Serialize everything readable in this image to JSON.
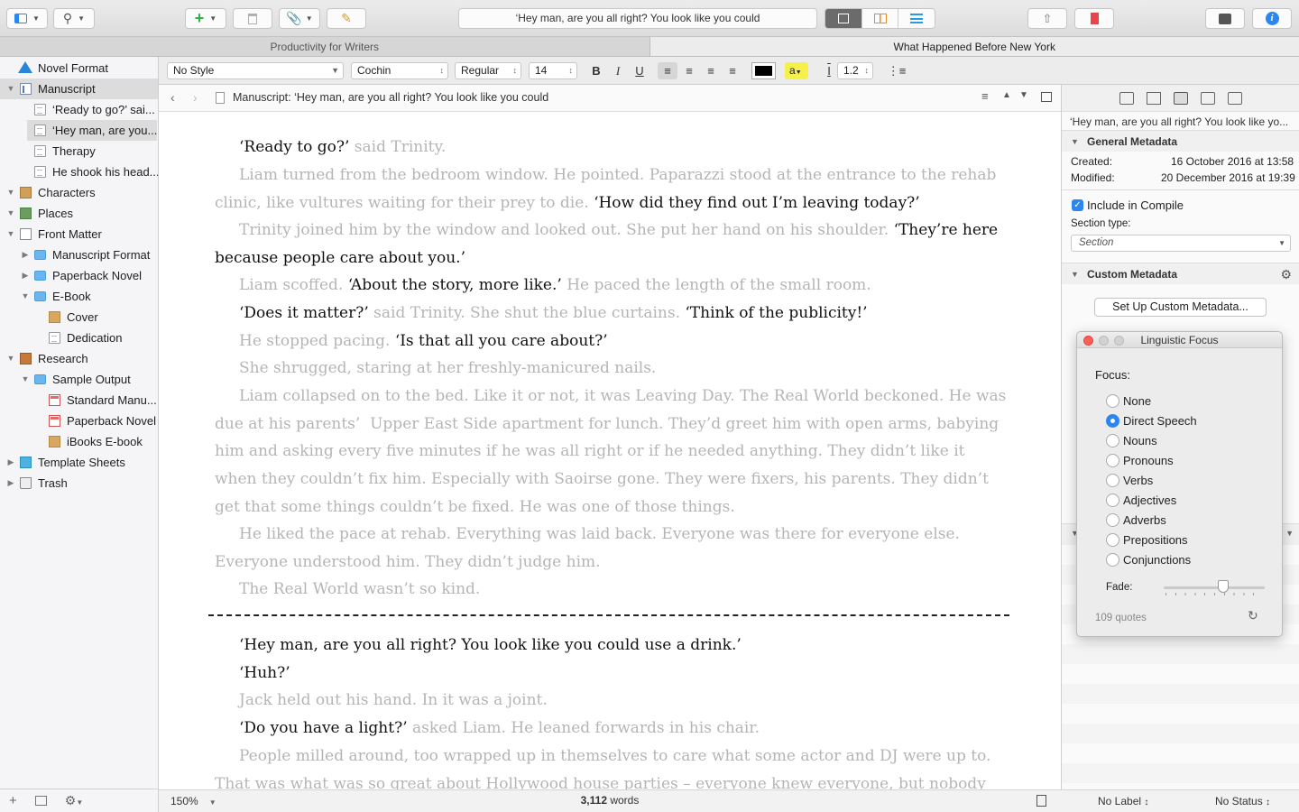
{
  "toolbar": {
    "title": "‘Hey man, are you all right? You look like you could",
    "icons": [
      "sidebar-icon",
      "search-icon",
      "add-icon",
      "trash-icon",
      "attach-icon",
      "compose-icon",
      "share-icon",
      "bookmark-icon",
      "composition-icon",
      "info-icon"
    ]
  },
  "tabs": [
    "Productivity for Writers",
    "What Happened Before New York"
  ],
  "binder": {
    "items": [
      {
        "label": "Novel Format"
      },
      {
        "label": "Manuscript"
      },
      {
        "label": "‘Ready to go?’ sai..."
      },
      {
        "label": "‘Hey man, are you..."
      },
      {
        "label": "Therapy"
      },
      {
        "label": "He shook his head..."
      },
      {
        "label": "Characters"
      },
      {
        "label": "Places"
      },
      {
        "label": "Front Matter"
      },
      {
        "label": "Manuscript Format"
      },
      {
        "label": "Paperback Novel"
      },
      {
        "label": "E-Book"
      },
      {
        "label": "Cover"
      },
      {
        "label": "Dedication"
      },
      {
        "label": "Research"
      },
      {
        "label": "Sample Output"
      },
      {
        "label": "Standard Manu..."
      },
      {
        "label": "Paperback Novel"
      },
      {
        "label": "iBooks E-book"
      },
      {
        "label": "Template Sheets"
      },
      {
        "label": "Trash"
      }
    ]
  },
  "format": {
    "style": "No Style",
    "font": "Cochin",
    "weight": "Regular",
    "size": "14",
    "line_spacing": "1.2",
    "bold": "B",
    "italic": "I",
    "underline": "U",
    "highlight": "a"
  },
  "editor": {
    "path": "Manuscript: ‘Hey man, are you all right? You look like you could"
  },
  "status": {
    "zoom": "150%",
    "word_count": "3,112",
    "words_label": "words",
    "label": "No Label",
    "status": "No Status"
  },
  "inspector": {
    "title": "‘Hey man, are you all right? You look like yo...",
    "general_header": "General Metadata",
    "created_label": "Created:",
    "created_value": "16 October 2016 at 13:58",
    "modified_label": "Modified:",
    "modified_value": "20 December 2016 at 19:39",
    "include_compile": "Include in Compile",
    "section_type_label": "Section type:",
    "section_type_value": "Section",
    "custom_header": "Custom Metadata",
    "setup_button": "Set Up Custom Metadata..."
  },
  "focus_panel": {
    "title": "Linguistic Focus",
    "focus_label": "Focus:",
    "options": [
      "None",
      "Direct Speech",
      "Nouns",
      "Pronouns",
      "Verbs",
      "Adjectives",
      "Adverbs",
      "Prepositions",
      "Conjunctions"
    ],
    "selected": "Direct Speech",
    "fade_label": "Fade:",
    "fade_level": 0.6,
    "quote_count": "109 quotes"
  },
  "colors": {
    "accent": "#2a86f0",
    "dim_text": "#b5b5b5",
    "focus_text": "#111111"
  }
}
